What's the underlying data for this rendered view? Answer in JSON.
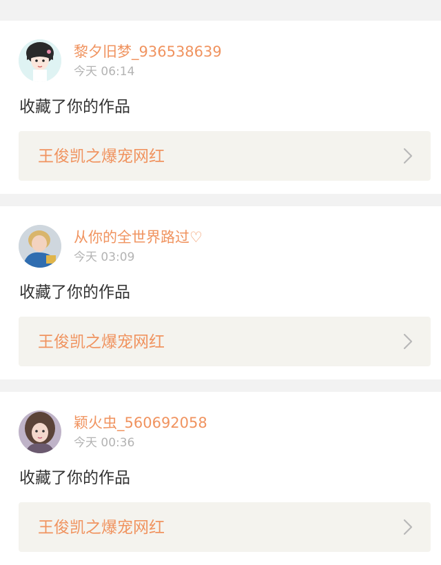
{
  "notifications": [
    {
      "username": "黎夕旧梦_936538639",
      "time": "今天 06:14",
      "action": "收藏了你的作品",
      "work_title": "王俊凯之爆宠网红"
    },
    {
      "username": "从你的全世界路过♡",
      "time": "今天 03:09",
      "action": "收藏了你的作品",
      "work_title": "王俊凯之爆宠网红"
    },
    {
      "username": "颖火虫_560692058",
      "time": "今天 00:36",
      "action": "收藏了你的作品",
      "work_title": "王俊凯之爆宠网红"
    }
  ],
  "colors": {
    "accent": "#f0935f",
    "text": "#333333",
    "muted": "#b3b3b3",
    "link_bg": "#f4f3ee",
    "page_bg": "#f2f2f2"
  },
  "icons": {
    "chevron": "chevron-right-icon"
  }
}
